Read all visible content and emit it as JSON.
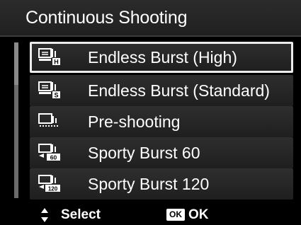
{
  "header": {
    "title": "Continuous Shooting"
  },
  "menu": {
    "items": [
      {
        "label": "Endless Burst (High)",
        "icon": "endless-burst-high-icon",
        "selected": true
      },
      {
        "label": "Endless Burst (Standard)",
        "icon": "endless-burst-standard-icon",
        "selected": false
      },
      {
        "label": "Pre-shooting",
        "icon": "pre-shooting-icon",
        "selected": false
      },
      {
        "label": "Sporty Burst 60",
        "icon": "sporty-burst-60-icon",
        "selected": false
      },
      {
        "label": "Sporty Burst 120",
        "icon": "sporty-burst-120-icon",
        "selected": false
      }
    ],
    "icon_badges": {
      "high": "H",
      "standard": "S",
      "sporty_60": "60",
      "sporty_120": "120"
    }
  },
  "footer": {
    "select_label": "Select",
    "ok_badge": "OK",
    "ok_label": "OK"
  },
  "colors": {
    "background": "#000000",
    "bar": "#2a2a2a",
    "selection_border": "#ececec",
    "text": "#ffffff"
  }
}
